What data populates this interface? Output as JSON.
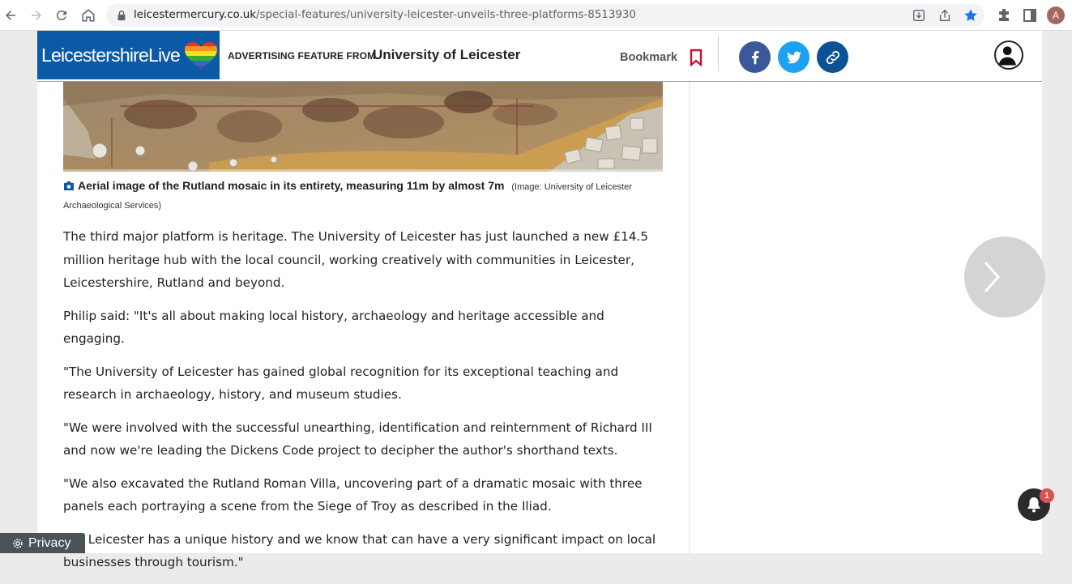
{
  "browser": {
    "url_host": "leicestermercury.co.uk",
    "url_path": "/special-features/university-leicester-unveils-three-platforms-8513930",
    "profile_initial": "A"
  },
  "header": {
    "logo_text": "LeicestershireLive",
    "advertising_label": "ADVERTISING FEATURE FROM",
    "sponsor": "University of Leicester",
    "bookmark_label": "Bookmark"
  },
  "caption": {
    "main": "Aerial image of the Rutland mosaic in its entirety, measuring 11m by almost 7m",
    "credit": "(Image: University of Leicester Archaeological Services)"
  },
  "article": {
    "paragraphs": [
      "The third major platform is heritage. The University of Leicester has just launched a new £14.5 million heritage hub with the local council, working creatively with communities in Leicester, Leicestershire, Rutland and beyond.",
      "Philip said: \"It's all about making local history, archaeology and heritage accessible and engaging.",
      "\"The University of Leicester has gained global recognition for its exceptional teaching and research in archaeology, history, and museum studies.",
      "\"We were involved with the successful unearthing, identification and reinternment of Richard III and now we're leading the Dickens Code project to decipher the author's shorthand texts.",
      "\"We also excavated the Rutland Roman Villa, uncovering part of a dramatic mosaic with three panels each portraying a scene from the Siege of Troy as described in the Iliad.",
      "\"So Leicester has a unique history and we know that can have a very significant impact on local businesses through tourism.\""
    ]
  },
  "notifications": {
    "count": "1"
  },
  "privacy": {
    "label": "Privacy"
  }
}
